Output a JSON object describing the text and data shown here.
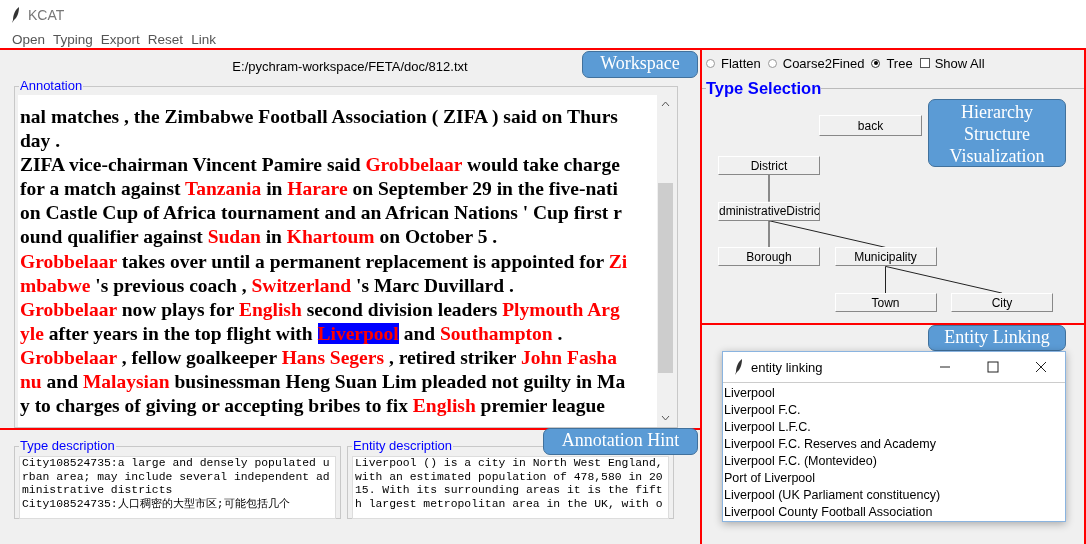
{
  "window": {
    "title": "KCAT"
  },
  "menu": [
    "Open",
    "Typing",
    "Export",
    "Reset",
    "Link"
  ],
  "workspace": {
    "callout": "Workspace",
    "path": "E:/pychram-workspace/FETA/doc/812.txt"
  },
  "annotation": {
    "title": "Annotation",
    "lines": [
      [
        {
          "text": "nal matches , the Zimbabwe Football Association ( ZIFA ) said on Thurs",
          "entity": false
        }
      ],
      [
        {
          "text": "day .",
          "entity": false
        }
      ],
      [
        {
          "text": "ZIFA vice-chairman Vincent Pamire said ",
          "entity": false
        },
        {
          "text": "Grobbelaar",
          "entity": true,
          "selected": false
        },
        {
          "text": " would take charge",
          "entity": false
        }
      ],
      [
        {
          "text": "for a match against ",
          "entity": false
        },
        {
          "text": "Tanzania",
          "entity": true,
          "selected": false
        },
        {
          "text": " in ",
          "entity": false
        },
        {
          "text": "Harare",
          "entity": true,
          "selected": false
        },
        {
          "text": " on September 29 in the five-nati",
          "entity": false
        }
      ],
      [
        {
          "text": "on Castle Cup of Africa tournament and an African Nations ' Cup first r",
          "entity": false
        }
      ],
      [
        {
          "text": "ound qualifier against ",
          "entity": false
        },
        {
          "text": "Sudan",
          "entity": true,
          "selected": false
        },
        {
          "text": " in ",
          "entity": false
        },
        {
          "text": "Khartoum",
          "entity": true,
          "selected": false
        },
        {
          "text": " on October 5 .",
          "entity": false
        }
      ],
      [
        {
          "text": "Grobbelaar",
          "entity": true,
          "selected": false
        },
        {
          "text": " takes over until a permanent replacement is appointed for ",
          "entity": false
        },
        {
          "text": "Zi",
          "entity": true,
          "selected": false
        }
      ],
      [
        {
          "text": "mbabwe",
          "entity": true,
          "selected": false
        },
        {
          "text": " 's previous coach , ",
          "entity": false
        },
        {
          "text": "Switzerland",
          "entity": true,
          "selected": false
        },
        {
          "text": " 's Marc Duvillard .",
          "entity": false
        }
      ],
      [
        {
          "text": "Grobbelaar",
          "entity": true,
          "selected": false
        },
        {
          "text": " now plays for ",
          "entity": false
        },
        {
          "text": "English",
          "entity": true,
          "selected": false
        },
        {
          "text": " second division leaders ",
          "entity": false
        },
        {
          "text": "Plymouth Arg",
          "entity": true,
          "selected": false
        }
      ],
      [
        {
          "text": "yle",
          "entity": true,
          "selected": false
        },
        {
          "text": " after years in the top flight with ",
          "entity": false
        },
        {
          "text": "Liverpool",
          "entity": true,
          "selected": true
        },
        {
          "text": " and ",
          "entity": false
        },
        {
          "text": "Southampton",
          "entity": true,
          "selected": false
        },
        {
          "text": " .",
          "entity": false
        }
      ],
      [
        {
          "text": "Grobbelaar",
          "entity": true,
          "selected": false
        },
        {
          "text": " , fellow goalkeeper ",
          "entity": false
        },
        {
          "text": "Hans Segers",
          "entity": true,
          "selected": false
        },
        {
          "text": " , retired striker ",
          "entity": false
        },
        {
          "text": "John Fasha",
          "entity": true,
          "selected": false
        }
      ],
      [
        {
          "text": "nu",
          "entity": true,
          "selected": false
        },
        {
          "text": " and ",
          "entity": false
        },
        {
          "text": "Malaysian",
          "entity": true,
          "selected": false
        },
        {
          "text": " businessman Heng Suan Lim pleaded not guilty in Ma",
          "entity": false
        }
      ],
      [
        {
          "text": "y to charges of giving or accepting bribes to fix ",
          "entity": false
        },
        {
          "text": "English",
          "entity": true,
          "selected": false
        },
        {
          "text": " premier league",
          "entity": false
        }
      ]
    ]
  },
  "hint": {
    "callout": "Annotation Hint",
    "type_description": {
      "title": "Type description",
      "lines": [
        "City108524735:a large and densely populated u",
        "rban area; may include several independent ad",
        "ministrative districts",
        "City108524735:人口稠密的大型市区;可能包括几个"
      ]
    },
    "entity_description": {
      "title": "Entity description",
      "lines": [
        "Liverpool () is a city in North West England,",
        "with an estimated population of 478,580 in 20",
        "15. With its surrounding areas it is the fift",
        "h largest metropolitan area in the UK, with o"
      ]
    }
  },
  "view_modes": [
    {
      "label": "Flatten",
      "selected": false
    },
    {
      "label": "Coarse2Fined",
      "selected": false
    },
    {
      "label": "Tree",
      "selected": true
    }
  ],
  "show_all": {
    "label": "Show All",
    "checked": false
  },
  "type_selection": {
    "title": "Type Selection",
    "callout": "Hierarchy\nStructure\nVisualization",
    "back": "back",
    "tree": {
      "label": "District",
      "children": [
        {
          "label": "dministrativeDistric",
          "children": [
            {
              "label": "Borough"
            },
            {
              "label": "Municipality",
              "children": [
                {
                  "label": "Town"
                },
                {
                  "label": "City"
                }
              ]
            }
          ]
        }
      ]
    }
  },
  "entity_linking": {
    "callout": "Entity Linking",
    "window_title": "entity linking",
    "candidates": [
      "Liverpool",
      "Liverpool F.C.",
      "Liverpool L.F.C.",
      "Liverpool F.C. Reserves and Academy",
      "Liverpool F.C. (Montevideo)",
      "Port of Liverpool",
      "Liverpool (UK Parliament constituency)",
      "Liverpool County Football Association"
    ]
  }
}
